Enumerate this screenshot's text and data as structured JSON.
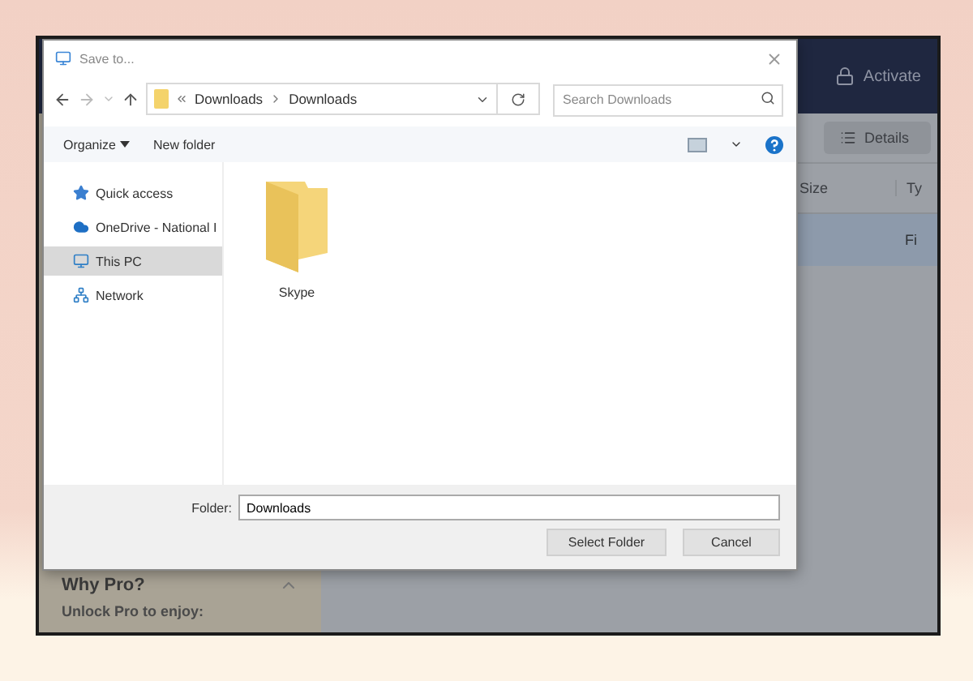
{
  "app": {
    "header": {
      "action": "Activate"
    },
    "toolbar": {
      "view_button": "Details"
    },
    "table": {
      "columns": [
        "Size",
        "Ty"
      ],
      "rows": [
        {
          "cells": [
            "",
            "Fi"
          ],
          "selected": true
        }
      ]
    },
    "sidebar": {
      "heading": "Why Pro?",
      "text": "Unlock Pro to enjoy:"
    }
  },
  "dialog": {
    "title": "Save to...",
    "breadcrumb": [
      "Downloads",
      "Downloads"
    ],
    "search": {
      "placeholder": "Search Downloads"
    },
    "toolbar": {
      "organize": "Organize",
      "new_folder": "New folder"
    },
    "nav_items": [
      {
        "label": "Quick access",
        "kind": "star",
        "selected": false
      },
      {
        "label": "OneDrive - National I",
        "kind": "cloud",
        "selected": false
      },
      {
        "label": "This PC",
        "kind": "pc",
        "selected": true
      },
      {
        "label": "Network",
        "kind": "network",
        "selected": false
      }
    ],
    "files": [
      {
        "name": "Skype",
        "kind": "folder"
      }
    ],
    "folder_field": {
      "label": "Folder:",
      "value": "Downloads"
    },
    "buttons": [
      "Select Folder",
      "Cancel"
    ]
  }
}
